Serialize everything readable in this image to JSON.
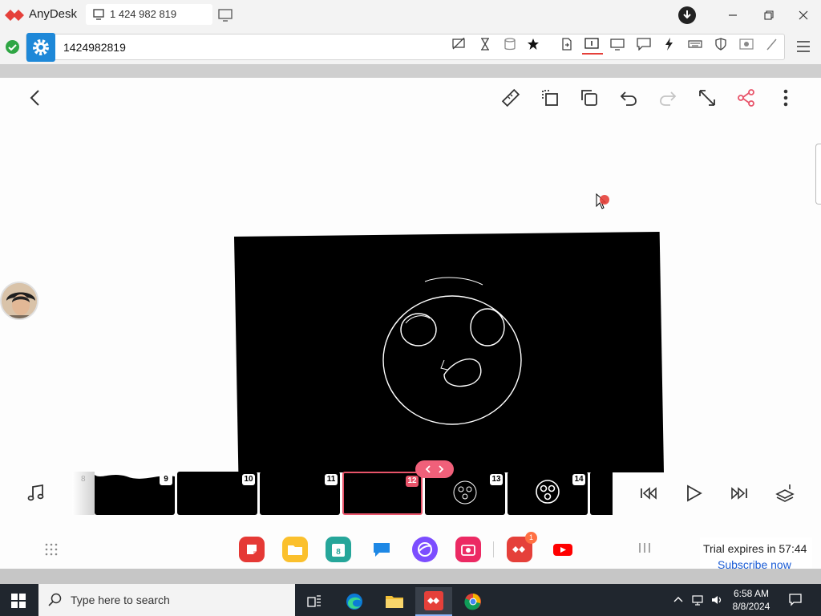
{
  "anydesk": {
    "app_name": "AnyDesk",
    "tab_label": "1 424 982 819",
    "address_value": "1424982819"
  },
  "frames": [
    {
      "num": "8"
    },
    {
      "num": "9"
    },
    {
      "num": "10"
    },
    {
      "num": "11"
    },
    {
      "num": "12",
      "selected": true
    },
    {
      "num": "13"
    },
    {
      "num": "14"
    }
  ],
  "dock": {
    "badge_count": "1",
    "trial_message": "Trial expires in 57:44",
    "subscribe_link": "Subscribe now"
  },
  "taskbar": {
    "search_placeholder": "Type here to search",
    "time": "6:58 AM",
    "date": "8/8/2024"
  },
  "colors": {
    "accent_pink": "#e8546a",
    "anydesk_red": "#e5403a",
    "taskbar_bg": "#20262e"
  }
}
